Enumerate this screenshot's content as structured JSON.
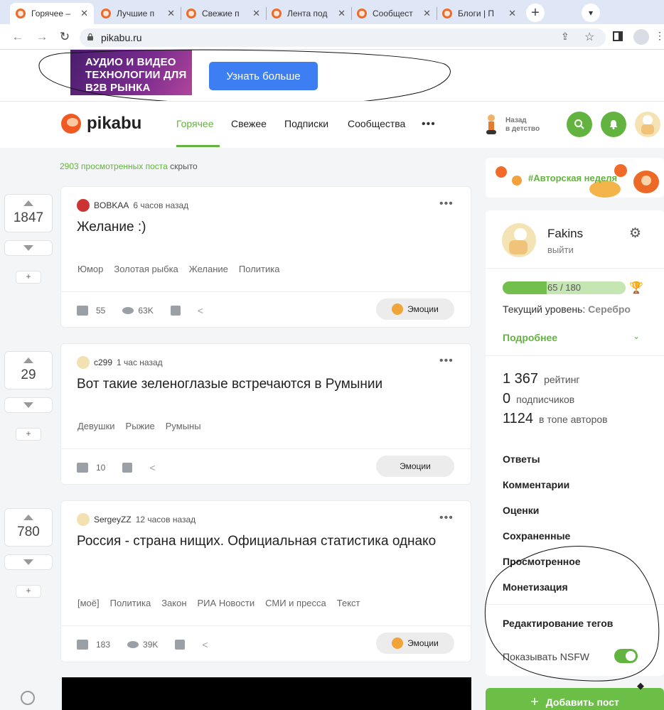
{
  "browser": {
    "tabs": [
      {
        "title": "Горячее –"
      },
      {
        "title": "Лучшие п"
      },
      {
        "title": "Свежие п"
      },
      {
        "title": "Лента под"
      },
      {
        "title": "Сообщест"
      },
      {
        "title": "Блоги | П"
      }
    ],
    "tab_close": "✕",
    "new_tab": "+",
    "url": "pikabu.ru"
  },
  "ad": {
    "image_text": "АУДИО И ВИДЕО ТЕХНОЛОГИИ ДЛЯ B2B РЫНКА",
    "button": "Узнать больше"
  },
  "header": {
    "logo": "pikabu",
    "nav": [
      "Горячее",
      "Свежее",
      "Подписки",
      "Сообщества"
    ],
    "more": "•••",
    "nostalgia": [
      "Назад",
      "в детство"
    ]
  },
  "feed": {
    "hidden_count": "2903 просмотренных поста",
    "hidden_suffix": " скрыто",
    "emotions_label": "Эмоции",
    "posts": [
      {
        "rating": "1847",
        "author": "BOBKAA",
        "time": "6 часов назад",
        "title": "Желание :)",
        "tags": [
          "Юмор",
          "Золотая рыбка",
          "Желание",
          "Политика"
        ],
        "comments": "55",
        "views": "63K"
      },
      {
        "rating": "29",
        "author": "c299",
        "time": "1 час назад",
        "title": "Вот такие зеленоглазые встречаются в Румынии",
        "tags": [
          "Девушки",
          "Рыжие",
          "Румыны"
        ],
        "comments": "10",
        "views": ""
      },
      {
        "rating": "780",
        "author": "SergeyZZ",
        "time": "12 часов назад",
        "title": "Россия - страна нищих. Официальная статистика однако",
        "tags": [
          "[моё]",
          "Политика",
          "Закон",
          "РИА Новости",
          "СМИ и пресса",
          "Текст"
        ],
        "comments": "183",
        "views": "39K"
      }
    ]
  },
  "sidebar": {
    "banner": "#Авторская неделя",
    "username": "Fakins",
    "logout": "выйти",
    "level_progress": "65 / 180",
    "level_fraction": 0.36,
    "current_level_label": "Текущий уровень:",
    "current_level": "Серебро",
    "details": "Подробнее",
    "stats": [
      {
        "value": "1 367",
        "label": "рейтинг"
      },
      {
        "value": "0",
        "label": "подписчиков"
      },
      {
        "value": "1124",
        "label": "в топе авторов"
      }
    ],
    "menu": [
      "Ответы",
      "Комментарии",
      "Оценки",
      "Сохраненные",
      "Просмотренное",
      "Монетизация",
      "Редактирование тегов"
    ],
    "nsfw": "Показывать NSFW",
    "add_post": "Добавить пост"
  },
  "colors": {
    "accent": "#62b33f",
    "ad_button": "#3d7ff2",
    "brand": "#f05a22"
  }
}
